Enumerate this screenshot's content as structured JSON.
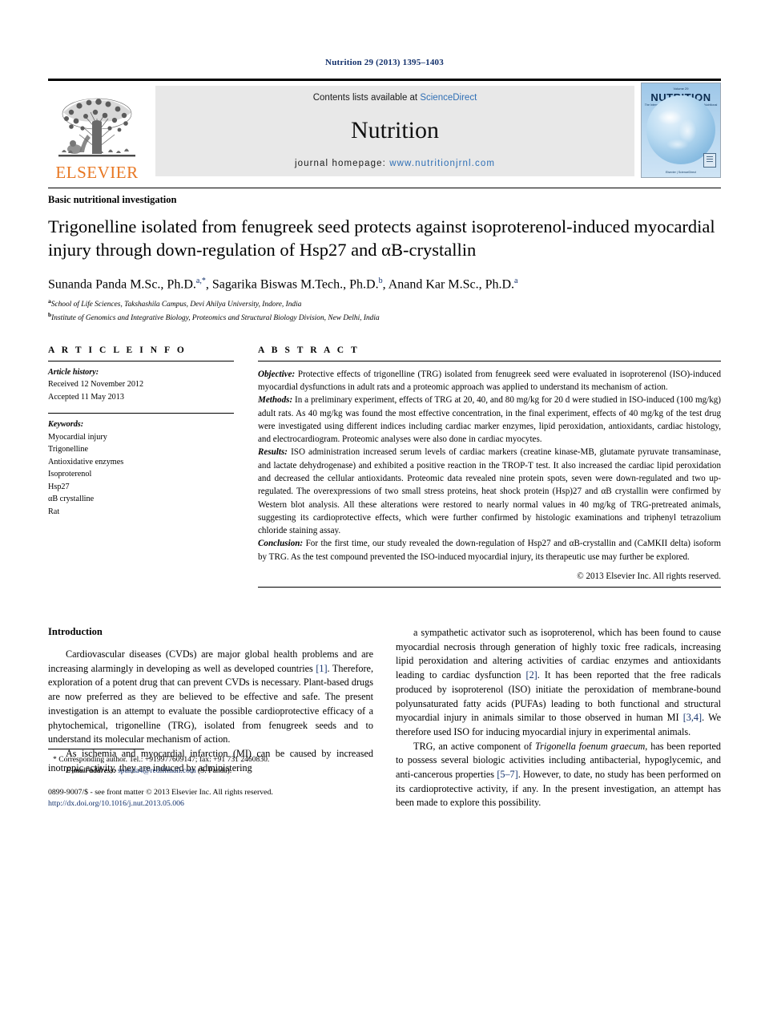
{
  "running_head": "Nutrition 29 (2013) 1395–1403",
  "masthead": {
    "publisher_name": "ELSEVIER",
    "contents_prefix": "Contents lists available at ",
    "contents_link": "ScienceDirect",
    "journal_name": "Nutrition",
    "homepage_prefix": "journal homepage: ",
    "homepage_url": "www.nutritionjrnl.com",
    "cover": {
      "volume_line": "Volume 29",
      "title": "NUTRITION",
      "subtitle": "The International Journal of Applied and Basic Nutritional Sciences",
      "footer": "Elsevier | ScienceDirect"
    }
  },
  "section_type": "Basic nutritional investigation",
  "title": "Trigonelline isolated from fenugreek seed protects against isoproterenol-induced myocardial injury through down-regulation of Hsp27 and αB-crystallin",
  "authors": [
    {
      "name": "Sunanda Panda M.Sc., Ph.D.",
      "marks": "a,*"
    },
    {
      "name": "Sagarika Biswas M.Tech., Ph.D.",
      "marks": "b"
    },
    {
      "name": "Anand Kar M.Sc., Ph.D.",
      "marks": "a"
    }
  ],
  "affiliations": [
    {
      "mark": "a",
      "text": "School of Life Sciences, Takshashila Campus, Devi Ahilya University, Indore, India"
    },
    {
      "mark": "b",
      "text": "Institute of Genomics and Integrative Biology, Proteomics and Structural Biology Division, New Delhi, India"
    }
  ],
  "article_info": {
    "heading": "A R T I C L E   I N F O",
    "history_label": "Article history:",
    "history_lines": [
      "Received 12 November 2012",
      "Accepted 11 May 2013"
    ],
    "keywords_label": "Keywords:",
    "keywords": [
      "Myocardial injury",
      "Trigonelline",
      "Antioxidative enzymes",
      "Isoproterenol",
      "Hsp27",
      "αB crystalline",
      "Rat"
    ]
  },
  "abstract": {
    "heading": "A B S T R A C T",
    "sections": [
      {
        "label": "Objective:",
        "text": " Protective effects of trigonelline (TRG) isolated from fenugreek seed were evaluated in isoproterenol (ISO)-induced myocardial dysfunctions in adult rats and a proteomic approach was applied to understand its mechanism of action."
      },
      {
        "label": "Methods:",
        "text": " In a preliminary experiment, effects of TRG at 20, 40, and 80 mg/kg for 20 d were studied in ISO-induced (100 mg/kg) adult rats. As 40 mg/kg was found the most effective concentration, in the final experiment, effects of 40 mg/kg of the test drug were investigated using different indices including cardiac marker enzymes, lipid peroxidation, antioxidants, cardiac histology, and electrocardiogram. Proteomic analyses were also done in cardiac myocytes."
      },
      {
        "label": "Results:",
        "text": " ISO administration increased serum levels of cardiac markers (creatine kinase-MB, glutamate pyruvate transaminase, and lactate dehydrogenase) and exhibited a positive reaction in the TROP-T test. It also increased the cardiac lipid peroxidation and decreased the cellular antioxidants. Proteomic data revealed nine protein spots, seven were down-regulated and two up-regulated. The overexpressions of two small stress proteins, heat shock protein (Hsp)27 and αB crystallin were confirmed by Western blot analysis. All these alterations were restored to nearly normal values in 40 mg/kg of TRG-pretreated animals, suggesting its cardioprotective effects, which were further confirmed by histologic examinations and triphenyl tetrazolium chloride staining assay."
      },
      {
        "label": "Conclusion:",
        "text": " For the first time, our study revealed the down-regulation of Hsp27 and αB-crystallin and (CaMKII delta) isoform by TRG. As the test compound prevented the ISO-induced myocardial injury, its therapeutic use may further be explored."
      }
    ],
    "copyright": "© 2013 Elsevier Inc. All rights reserved."
  },
  "body": {
    "heading": "Introduction",
    "left_paragraphs": [
      {
        "parts": [
          {
            "t": "Cardiovascular diseases (CVDs) are major global health problems and are increasing alarmingly in developing as well as developed countries "
          },
          {
            "t": "[1]",
            "style": "ref"
          },
          {
            "t": ". Therefore, exploration of a potent drug that can prevent CVDs is necessary. Plant-based drugs are now preferred as they are believed to be effective and safe. The present investigation is an attempt to evaluate the possible cardioprotective efficacy of a phytochemical, trigonelline (TRG), isolated from fenugreek seeds and to understand its molecular mechanism of action."
          }
        ]
      },
      {
        "parts": [
          {
            "t": "As ischemia and myocardial infarction (MI) can be caused by increased inotropic activity, they are induced by administering"
          }
        ]
      }
    ],
    "right_paragraphs": [
      {
        "parts": [
          {
            "t": "a sympathetic activator such as isoproterenol, which has been found to cause myocardial necrosis through generation of highly toxic free radicals, increasing lipid peroxidation and altering activities of cardiac enzymes and antioxidants leading to cardiac dysfunction "
          },
          {
            "t": "[2]",
            "style": "ref"
          },
          {
            "t": ". It has been reported that the free radicals produced by isoproterenol (ISO) initiate the peroxidation of membrane-bound polyunsaturated fatty acids (PUFAs) leading to both functional and structural myocardial injury in animals similar to those observed in human MI "
          },
          {
            "t": "[3,4]",
            "style": "ref"
          },
          {
            "t": ". We therefore used ISO for inducing myocardial injury in experimental animals."
          }
        ],
        "noindent": false
      },
      {
        "parts": [
          {
            "t": "TRG, an active component of "
          },
          {
            "t": "Trigonella foenum graecum",
            "style": "ital"
          },
          {
            "t": ", has been reported to possess several biologic activities including antibacterial, hypoglycemic, and anti-cancerous properties "
          },
          {
            "t": "[5–7]",
            "style": "ref"
          },
          {
            "t": ". However, to date, no study has been performed on its cardioprotective activity, if any. In the present investigation, an attempt has been made to explore this possibility."
          }
        ]
      }
    ]
  },
  "footnote": {
    "corresponding": "* Corresponding author. Tel.: +919977609147; fax: +91 731 2460830.",
    "email_label": "E-mail address:",
    "email": "spanda4@rediffmail.com",
    "email_suffix": " (S. Panda).",
    "front_matter": "0899-9007/$ - see front matter © 2013 Elsevier Inc. All rights reserved.",
    "doi": "http://dx.doi.org/10.1016/j.nut.2013.05.006"
  }
}
